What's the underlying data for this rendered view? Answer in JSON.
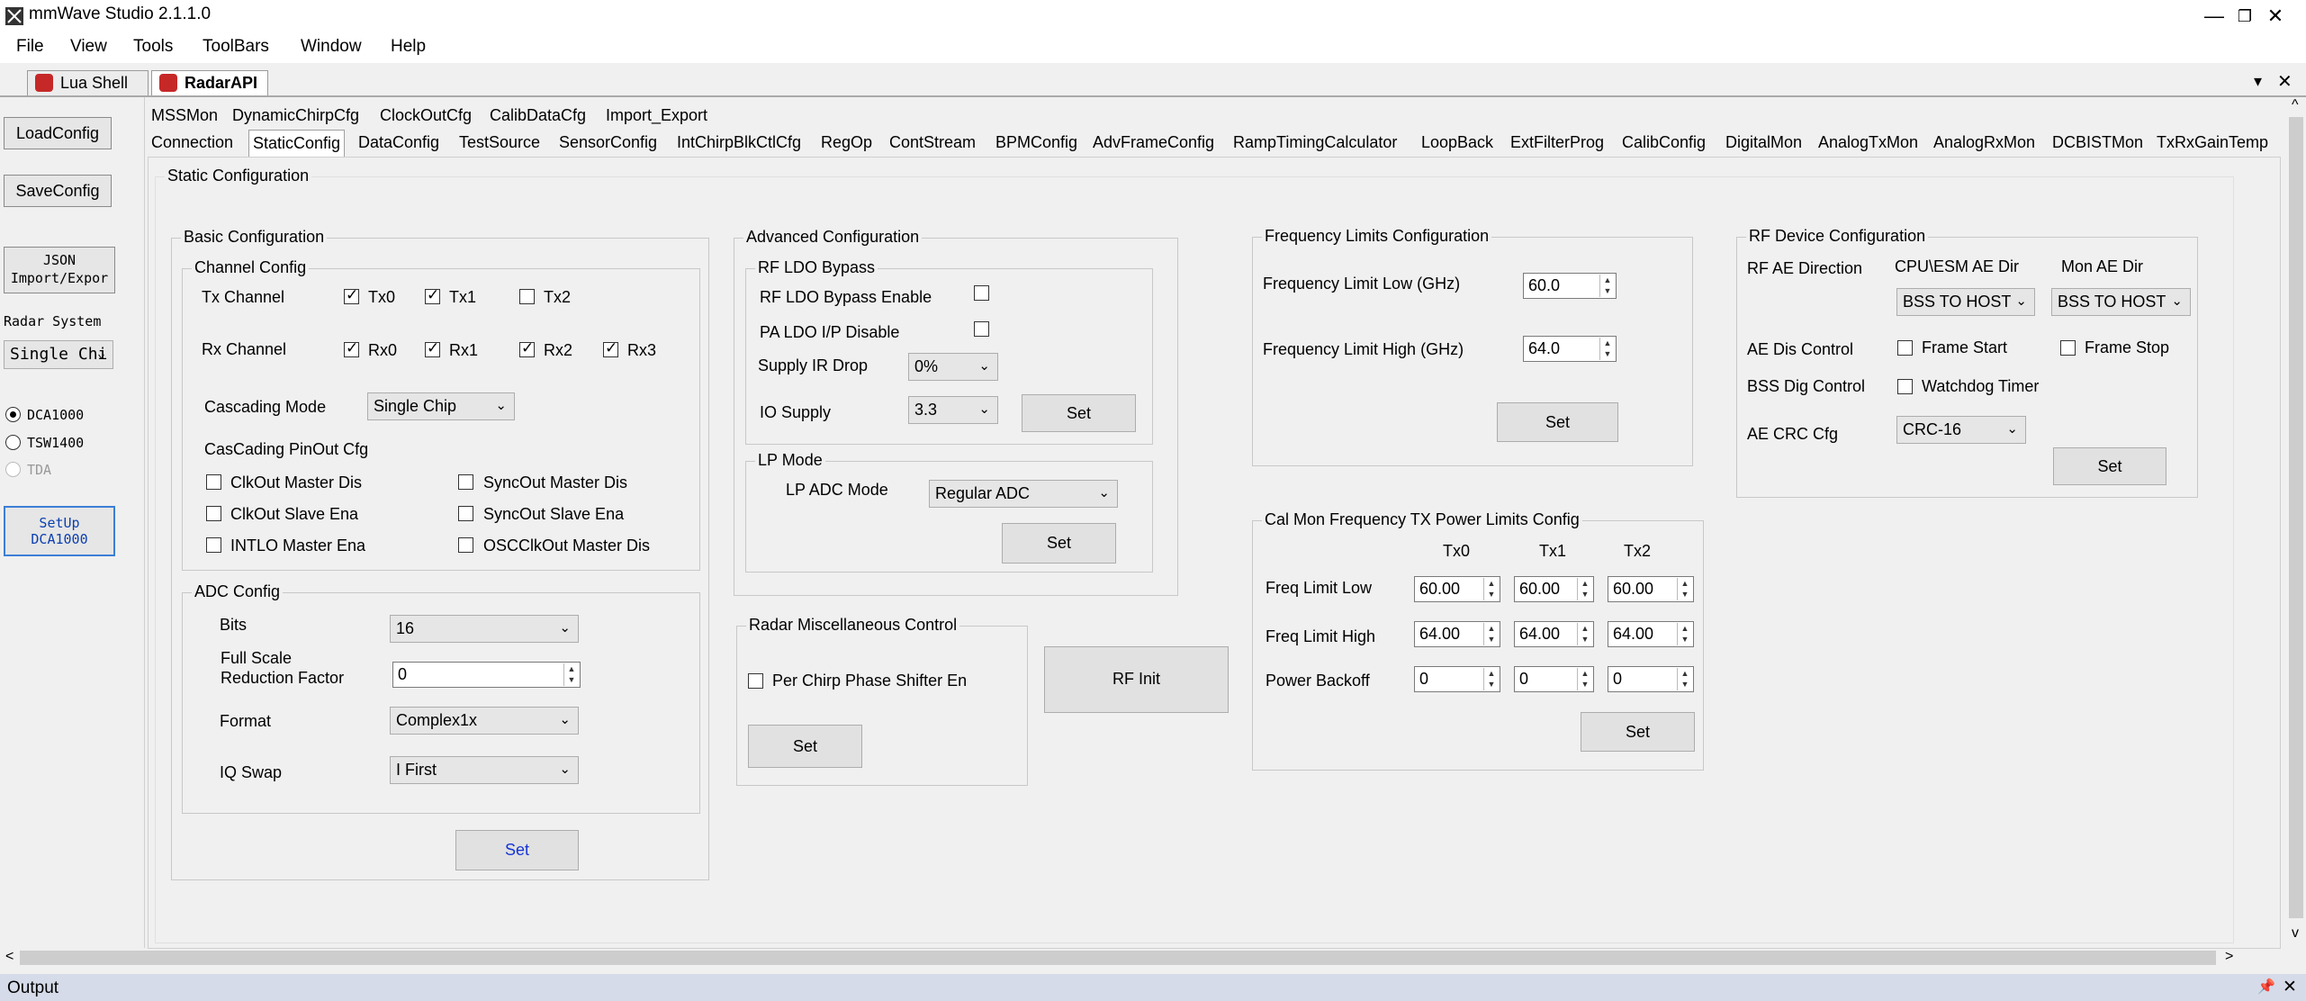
{
  "window": {
    "title": "mmWave Studio 2.1.1.0",
    "min": "—",
    "restore": "❐",
    "close": "✕"
  },
  "menu": [
    "File",
    "View",
    "Tools",
    "ToolBars",
    "Window",
    "Help"
  ],
  "doc_tabs": [
    "Lua Shell",
    "RadarAPI"
  ],
  "doc_ctrl": {
    "dropdown": "▾",
    "close": "✕"
  },
  "sidebar": {
    "load": "LoadConfig",
    "save": "SaveConfig",
    "json_l1": "JSON",
    "json_l2": "Import/Expor",
    "radar_system": "Radar System",
    "radar_system_value": "Single Chi",
    "radios": [
      "DCA1000",
      "TSW1400",
      "TDA"
    ],
    "setup_l1": "SetUp",
    "setup_l2": "DCA1000"
  },
  "tabs_row1": [
    "MSSMon",
    "DynamicChirpCfg",
    "ClockOutCfg",
    "CalibDataCfg",
    "Import_Export"
  ],
  "tabs_row2": [
    "Connection",
    "StaticConfig",
    "DataConfig",
    "TestSource",
    "SensorConfig",
    "IntChirpBlkCtlCfg",
    "RegOp",
    "ContStream",
    "BPMConfig",
    "AdvFrameConfig",
    "RampTimingCalculator",
    "LoopBack",
    "ExtFilterProg",
    "CalibConfig",
    "DigitalMon",
    "AnalogTxMon",
    "AnalogRxMon",
    "DCBISTMon",
    "TxRxGainTemp"
  ],
  "static": {
    "title": "Static Configuration",
    "basic": {
      "title": "Basic Configuration",
      "channel": "Channel Config",
      "tx_label": "Tx Channel",
      "tx": [
        "Tx0",
        "Tx1",
        "Tx2"
      ],
      "rx_label": "Rx Channel",
      "rx": [
        "Rx0",
        "Rx1",
        "Rx2",
        "Rx3"
      ],
      "cascading_label": "Cascading Mode",
      "cascading_value": "Single Chip",
      "pinout": "CasCading PinOut Cfg",
      "pin_items": [
        "ClkOut Master Dis",
        "SyncOut Master Dis",
        "ClkOut Slave Ena",
        "SyncOut Slave Ena",
        "INTLO Master Ena",
        "OSCClkOut Master Dis"
      ]
    },
    "adc": {
      "title": "ADC Config",
      "bits_label": "Bits",
      "bits": "16",
      "fs_l1": "Full Scale",
      "fs_l2": "Reduction Factor",
      "fs": "0",
      "format_label": "Format",
      "format": "Complex1x",
      "iq_label": "IQ Swap",
      "iq": "I First",
      "set": "Set"
    },
    "advanced": {
      "title": "Advanced Configuration",
      "rfldo": "RF LDO Bypass",
      "rfldo_en": "RF LDO Bypass Enable",
      "pa_ldo": "PA LDO I/P Disable",
      "supply_ir": "Supply IR Drop",
      "supply_ir_val": "0%",
      "io": "IO Supply",
      "io_val": "3.3",
      "set": "Set",
      "lp": "LP Mode",
      "lp_adc": "LP ADC Mode",
      "lp_adc_val": "Regular ADC",
      "lp_set": "Set"
    },
    "misc": {
      "title": "Radar Miscellaneous Control",
      "per_chirp": "Per Chirp Phase Shifter En",
      "set": "Set",
      "rf_init": "RF Init"
    },
    "freq": {
      "title": "Frequency Limits Configuration",
      "low_label": "Frequency Limit Low (GHz)",
      "low": "60.0",
      "high_label": "Frequency Limit High (GHz)",
      "high": "64.0",
      "set": "Set"
    },
    "calmon": {
      "title": "Cal Mon Frequency TX Power Limits Config",
      "cols": [
        "Tx0",
        "Tx1",
        "Tx2"
      ],
      "rows": [
        {
          "label": "Freq Limit Low",
          "vals": [
            "60.00",
            "60.00",
            "60.00"
          ]
        },
        {
          "label": "Freq Limit High",
          "vals": [
            "64.00",
            "64.00",
            "64.00"
          ]
        },
        {
          "label": "Power Backoff",
          "vals": [
            "0",
            "0",
            "0"
          ]
        }
      ],
      "set": "Set"
    },
    "rfdev": {
      "title": "RF Device Configuration",
      "ae_dir": "RF AE Direction",
      "cpu_esm": "CPU\\ESM AE Dir",
      "mon_ae": "Mon AE Dir",
      "cpu_val": "BSS TO HOST",
      "mon_val": "BSS TO HOST",
      "ae_dis": "AE Dis Control",
      "frame_start": "Frame Start",
      "frame_stop": "Frame Stop",
      "bss_dig": "BSS Dig Control",
      "watchdog": "Watchdog Timer",
      "crc": "AE CRC Cfg",
      "crc_val": "CRC-16",
      "set": "Set"
    }
  },
  "output": {
    "title": "Output",
    "pin": "📌",
    "close": "✕"
  },
  "scroll": {
    "left": "<",
    "right": ">",
    "up": "^",
    "down": "v"
  }
}
